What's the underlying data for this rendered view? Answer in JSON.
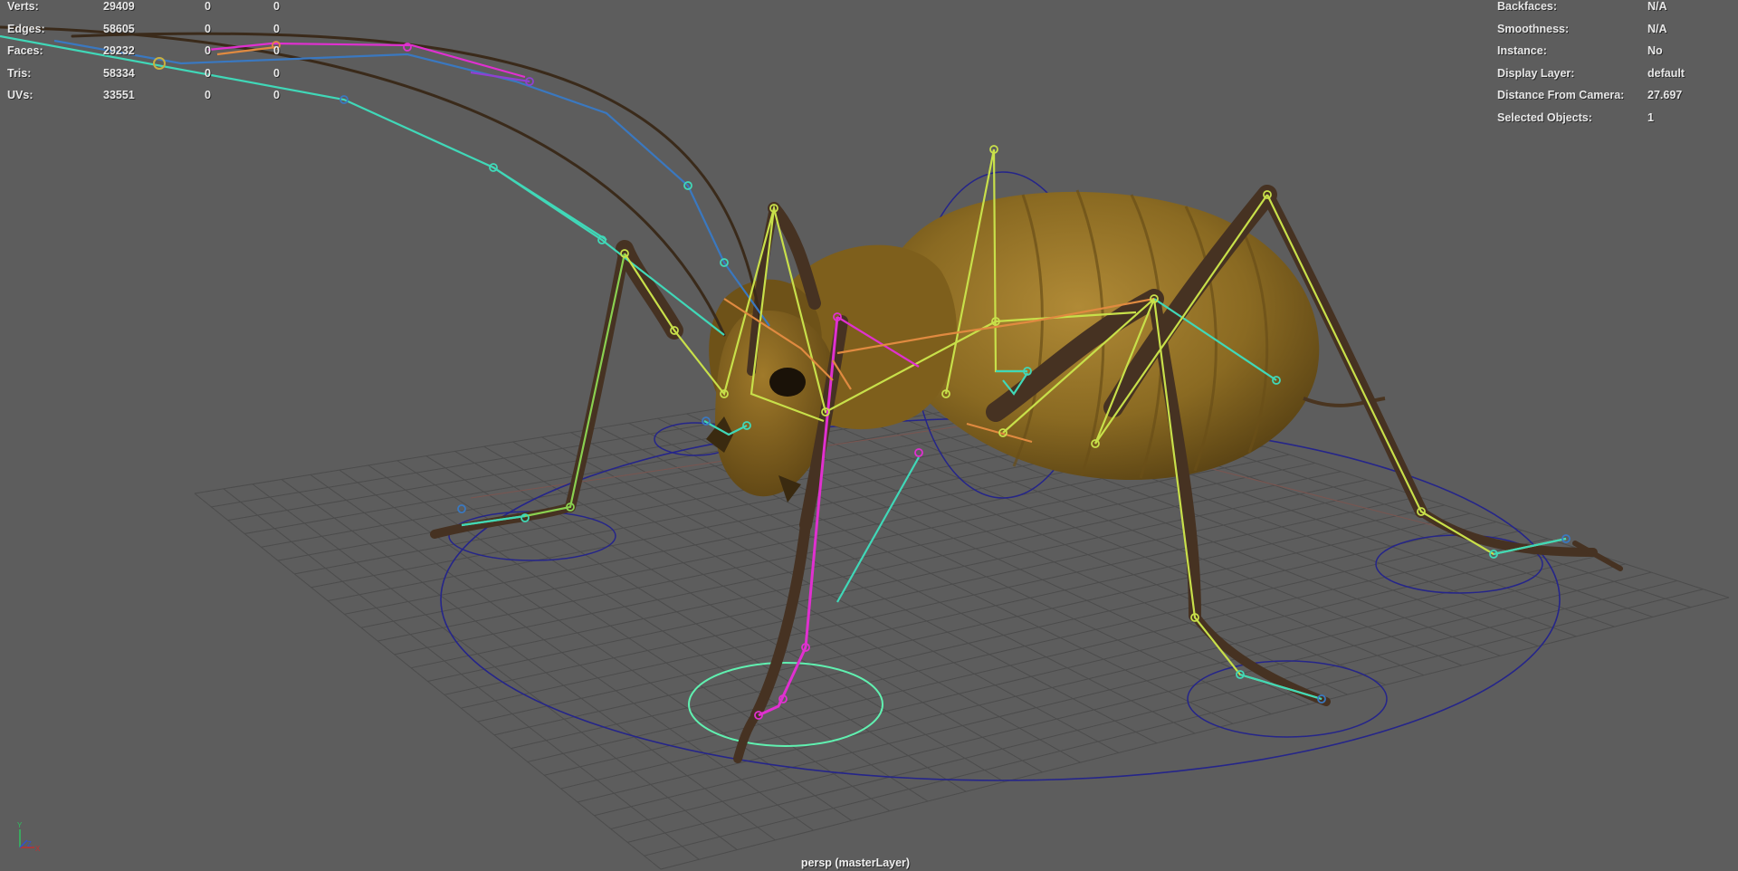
{
  "hud_left": {
    "rows": [
      {
        "label": "Verts:",
        "total": "29409",
        "selected": "0",
        "uv": "0"
      },
      {
        "label": "Edges:",
        "total": "58605",
        "selected": "0",
        "uv": "0"
      },
      {
        "label": "Faces:",
        "total": "29232",
        "selected": "0",
        "uv": "0"
      },
      {
        "label": "Tris:",
        "total": "58334",
        "selected": "0",
        "uv": "0"
      },
      {
        "label": "UVs:",
        "total": "33551",
        "selected": "0",
        "uv": "0"
      }
    ]
  },
  "hud_right": {
    "rows": [
      {
        "label": "Backfaces:",
        "value": "N/A"
      },
      {
        "label": "Smoothness:",
        "value": "N/A"
      },
      {
        "label": "Instance:",
        "value": "No"
      },
      {
        "label": "Display Layer:",
        "value": "default"
      },
      {
        "label": "Distance From Camera:",
        "value": "27.697"
      },
      {
        "label": "Selected Objects:",
        "value": "1"
      }
    ]
  },
  "camera_label": "persp (masterLayer)",
  "axis_gizmo": {
    "y": "Y",
    "z": "Z",
    "x": "X"
  },
  "colors": {
    "background": "#5d5d5d",
    "grid": "#4a4a4a",
    "grid_axis": "#7a5550",
    "body": "#8a6a22",
    "leg": "#4a3520",
    "joint_yellow": "#c8e04a",
    "joint_magenta": "#e030d0",
    "joint_cyan": "#40d8b8",
    "joint_orange": "#e08a40",
    "ctrl_blue": "#25258a",
    "ctrl_green": "#60f0b0"
  }
}
